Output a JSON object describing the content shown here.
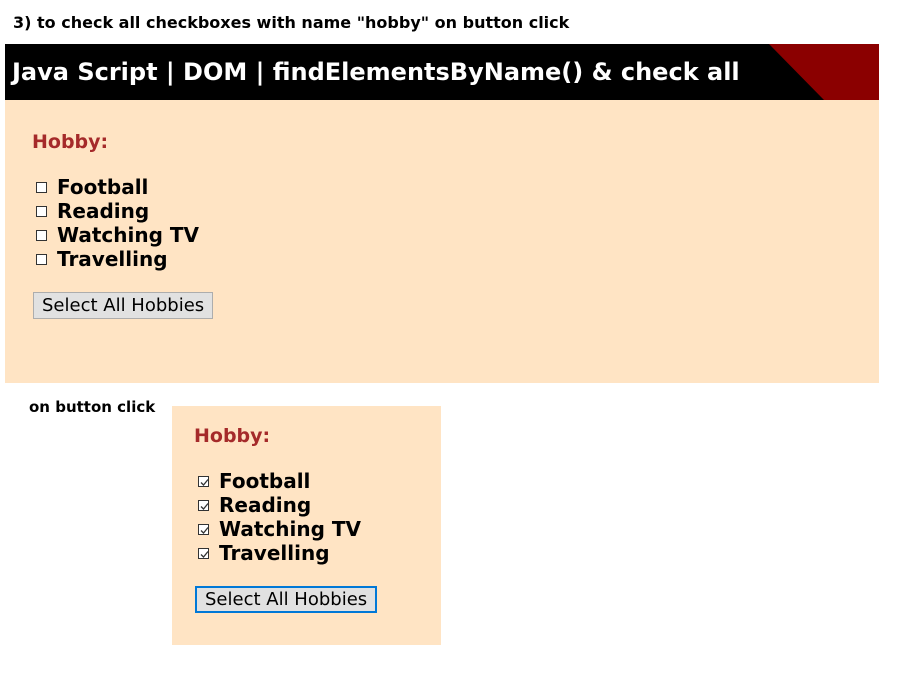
{
  "caption_top": "3) to check all checkboxes with name \"hobby\" on button click",
  "banner": {
    "title": "Java Script | DOM | findElementsByName() & check all",
    "accent_color": "#8b0000"
  },
  "before": {
    "label": "Hobby:",
    "items": [
      "Football",
      "Reading",
      "Watching TV",
      "Travelling"
    ],
    "checked": false,
    "button_label": "Select All Hobbies"
  },
  "caption_mid": "on button click",
  "after": {
    "label": "Hobby:",
    "items": [
      "Football",
      "Reading",
      "Watching TV",
      "Travelling"
    ],
    "checked": true,
    "button_label": "Select All Hobbies"
  },
  "colors": {
    "panel_bg": "#ffe4c4",
    "label_color": "#a52a2a"
  }
}
